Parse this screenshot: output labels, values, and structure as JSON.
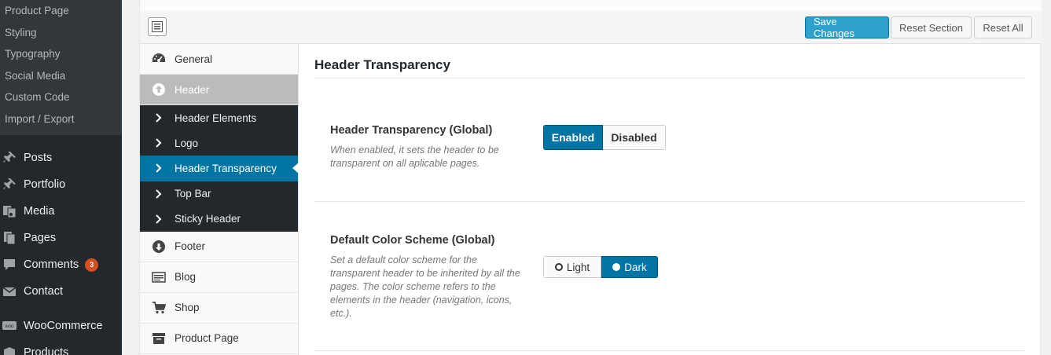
{
  "wp_sidebar": {
    "submenu": [
      "Product Page",
      "Styling",
      "Typography",
      "Social Media",
      "Custom Code",
      "Import / Export"
    ],
    "menu": [
      {
        "label": "Posts",
        "icon": "pin-icon"
      },
      {
        "label": "Portfolio",
        "icon": "pin-icon"
      },
      {
        "label": "Media",
        "icon": "media-icon"
      },
      {
        "label": "Pages",
        "icon": "pages-icon"
      },
      {
        "label": "Comments",
        "icon": "comments-icon",
        "badge": "3"
      },
      {
        "label": "Contact",
        "icon": "mail-icon"
      },
      {
        "label": "WooCommerce",
        "icon": "woo-icon"
      },
      {
        "label": "Products",
        "icon": "products-icon"
      }
    ]
  },
  "toolbar": {
    "save_label": "Save Changes",
    "reset_section_label": "Reset Section",
    "reset_all_label": "Reset All"
  },
  "section_menu": {
    "general": "General",
    "header": "Header",
    "sub": [
      "Header Elements",
      "Logo",
      "Header Transparency",
      "Top Bar",
      "Sticky Header"
    ],
    "footer": "Footer",
    "blog": "Blog",
    "shop": "Shop",
    "product_page": "Product Page"
  },
  "content": {
    "title": "Header Transparency",
    "field1": {
      "label": "Header Transparency (Global)",
      "desc": "When enabled, it sets the header to be transparent on all aplicable pages.",
      "options": [
        "Enabled",
        "Disabled"
      ],
      "selected": "Enabled"
    },
    "field2": {
      "label": "Default Color Scheme (Global)",
      "desc": "Set a default color scheme for the transparent header to be inherited by all the pages. The color scheme refers to the elements in the header (navigation, icons, etc.).",
      "options": [
        "Light",
        "Dark"
      ],
      "selected": "Dark"
    }
  },
  "colors": {
    "accent": "#0074a2",
    "save_button": "#2ea2cc",
    "badge": "#d54e21"
  }
}
